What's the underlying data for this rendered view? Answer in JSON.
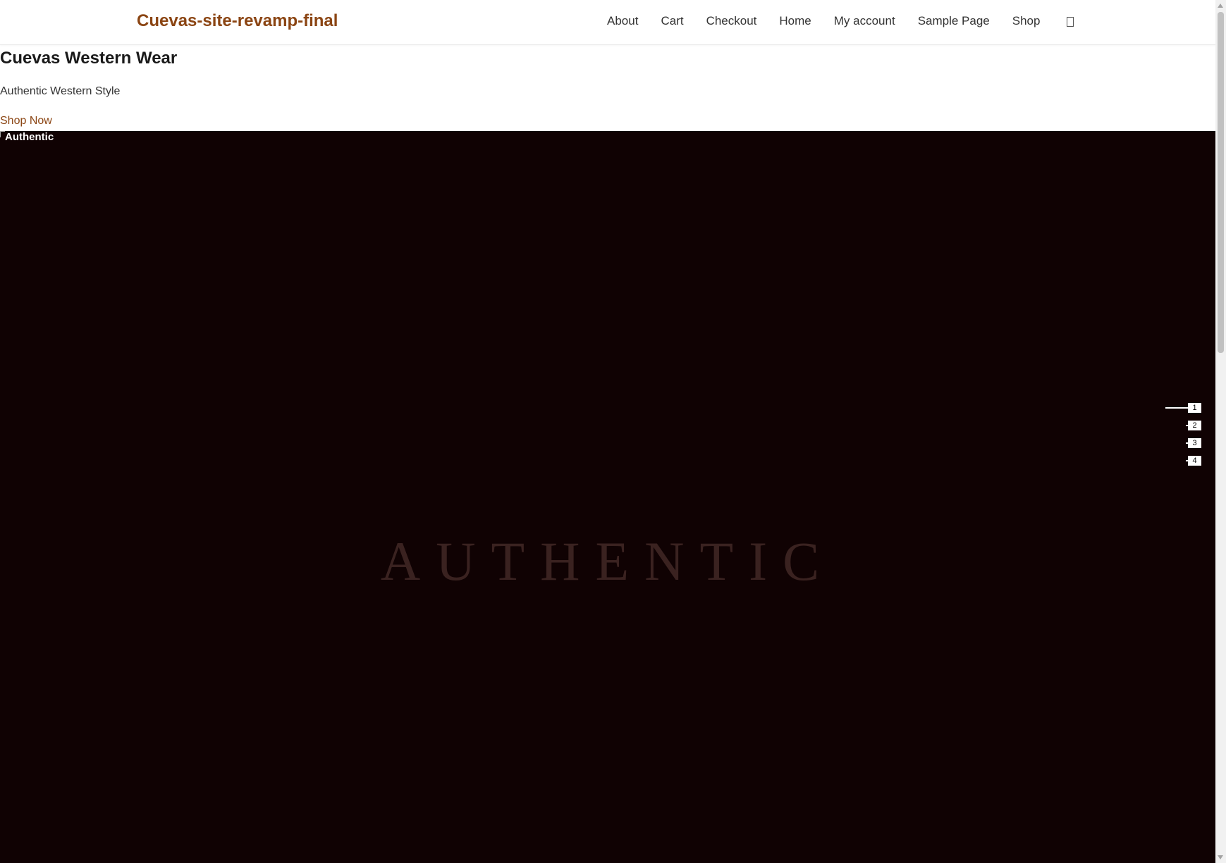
{
  "header": {
    "site_title": "Cuevas-site-revamp-final",
    "nav": [
      {
        "label": "About"
      },
      {
        "label": "Cart"
      },
      {
        "label": "Checkout"
      },
      {
        "label": "Home"
      },
      {
        "label": "My account"
      },
      {
        "label": "Sample Page"
      },
      {
        "label": "Shop"
      }
    ],
    "cart_icon": "cart-icon"
  },
  "intro": {
    "title": "Cuevas Western Wear",
    "subtitle": "Authentic Western Style",
    "cta": "Shop Now"
  },
  "hero": {
    "broken_image_alt": "Authentic",
    "word": "AUTHENTIC",
    "slides": [
      {
        "label": "1",
        "active": true
      },
      {
        "label": "2",
        "active": false
      },
      {
        "label": "3",
        "active": false
      },
      {
        "label": "4",
        "active": false
      }
    ]
  },
  "colors": {
    "brand": "#8b4513",
    "hero_bg": "#100203",
    "hero_word": "#3a2220"
  }
}
